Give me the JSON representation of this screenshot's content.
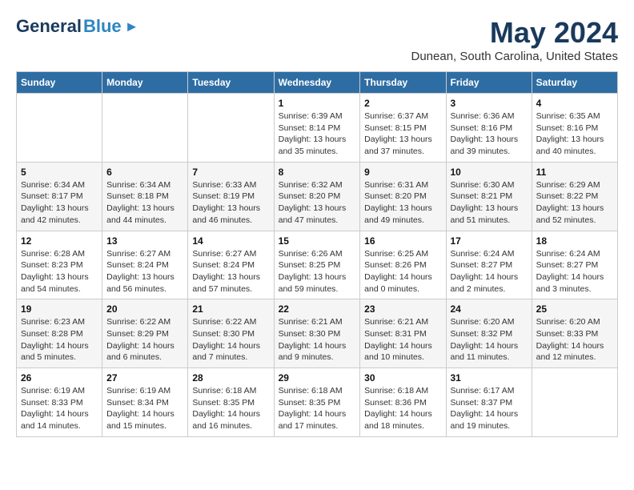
{
  "app": {
    "logo_general": "General",
    "logo_blue": "Blue",
    "month_year": "May 2024",
    "location": "Dunean, South Carolina, United States"
  },
  "calendar": {
    "headers": [
      "Sunday",
      "Monday",
      "Tuesday",
      "Wednesday",
      "Thursday",
      "Friday",
      "Saturday"
    ],
    "weeks": [
      [
        {
          "day": "",
          "info": ""
        },
        {
          "day": "",
          "info": ""
        },
        {
          "day": "",
          "info": ""
        },
        {
          "day": "1",
          "info": "Sunrise: 6:39 AM\nSunset: 8:14 PM\nDaylight: 13 hours\nand 35 minutes."
        },
        {
          "day": "2",
          "info": "Sunrise: 6:37 AM\nSunset: 8:15 PM\nDaylight: 13 hours\nand 37 minutes."
        },
        {
          "day": "3",
          "info": "Sunrise: 6:36 AM\nSunset: 8:16 PM\nDaylight: 13 hours\nand 39 minutes."
        },
        {
          "day": "4",
          "info": "Sunrise: 6:35 AM\nSunset: 8:16 PM\nDaylight: 13 hours\nand 40 minutes."
        }
      ],
      [
        {
          "day": "5",
          "info": "Sunrise: 6:34 AM\nSunset: 8:17 PM\nDaylight: 13 hours\nand 42 minutes."
        },
        {
          "day": "6",
          "info": "Sunrise: 6:34 AM\nSunset: 8:18 PM\nDaylight: 13 hours\nand 44 minutes."
        },
        {
          "day": "7",
          "info": "Sunrise: 6:33 AM\nSunset: 8:19 PM\nDaylight: 13 hours\nand 46 minutes."
        },
        {
          "day": "8",
          "info": "Sunrise: 6:32 AM\nSunset: 8:20 PM\nDaylight: 13 hours\nand 47 minutes."
        },
        {
          "day": "9",
          "info": "Sunrise: 6:31 AM\nSunset: 8:20 PM\nDaylight: 13 hours\nand 49 minutes."
        },
        {
          "day": "10",
          "info": "Sunrise: 6:30 AM\nSunset: 8:21 PM\nDaylight: 13 hours\nand 51 minutes."
        },
        {
          "day": "11",
          "info": "Sunrise: 6:29 AM\nSunset: 8:22 PM\nDaylight: 13 hours\nand 52 minutes."
        }
      ],
      [
        {
          "day": "12",
          "info": "Sunrise: 6:28 AM\nSunset: 8:23 PM\nDaylight: 13 hours\nand 54 minutes."
        },
        {
          "day": "13",
          "info": "Sunrise: 6:27 AM\nSunset: 8:24 PM\nDaylight: 13 hours\nand 56 minutes."
        },
        {
          "day": "14",
          "info": "Sunrise: 6:27 AM\nSunset: 8:24 PM\nDaylight: 13 hours\nand 57 minutes."
        },
        {
          "day": "15",
          "info": "Sunrise: 6:26 AM\nSunset: 8:25 PM\nDaylight: 13 hours\nand 59 minutes."
        },
        {
          "day": "16",
          "info": "Sunrise: 6:25 AM\nSunset: 8:26 PM\nDaylight: 14 hours\nand 0 minutes."
        },
        {
          "day": "17",
          "info": "Sunrise: 6:24 AM\nSunset: 8:27 PM\nDaylight: 14 hours\nand 2 minutes."
        },
        {
          "day": "18",
          "info": "Sunrise: 6:24 AM\nSunset: 8:27 PM\nDaylight: 14 hours\nand 3 minutes."
        }
      ],
      [
        {
          "day": "19",
          "info": "Sunrise: 6:23 AM\nSunset: 8:28 PM\nDaylight: 14 hours\nand 5 minutes."
        },
        {
          "day": "20",
          "info": "Sunrise: 6:22 AM\nSunset: 8:29 PM\nDaylight: 14 hours\nand 6 minutes."
        },
        {
          "day": "21",
          "info": "Sunrise: 6:22 AM\nSunset: 8:30 PM\nDaylight: 14 hours\nand 7 minutes."
        },
        {
          "day": "22",
          "info": "Sunrise: 6:21 AM\nSunset: 8:30 PM\nDaylight: 14 hours\nand 9 minutes."
        },
        {
          "day": "23",
          "info": "Sunrise: 6:21 AM\nSunset: 8:31 PM\nDaylight: 14 hours\nand 10 minutes."
        },
        {
          "day": "24",
          "info": "Sunrise: 6:20 AM\nSunset: 8:32 PM\nDaylight: 14 hours\nand 11 minutes."
        },
        {
          "day": "25",
          "info": "Sunrise: 6:20 AM\nSunset: 8:33 PM\nDaylight: 14 hours\nand 12 minutes."
        }
      ],
      [
        {
          "day": "26",
          "info": "Sunrise: 6:19 AM\nSunset: 8:33 PM\nDaylight: 14 hours\nand 14 minutes."
        },
        {
          "day": "27",
          "info": "Sunrise: 6:19 AM\nSunset: 8:34 PM\nDaylight: 14 hours\nand 15 minutes."
        },
        {
          "day": "28",
          "info": "Sunrise: 6:18 AM\nSunset: 8:35 PM\nDaylight: 14 hours\nand 16 minutes."
        },
        {
          "day": "29",
          "info": "Sunrise: 6:18 AM\nSunset: 8:35 PM\nDaylight: 14 hours\nand 17 minutes."
        },
        {
          "day": "30",
          "info": "Sunrise: 6:18 AM\nSunset: 8:36 PM\nDaylight: 14 hours\nand 18 minutes."
        },
        {
          "day": "31",
          "info": "Sunrise: 6:17 AM\nSunset: 8:37 PM\nDaylight: 14 hours\nand 19 minutes."
        },
        {
          "day": "",
          "info": ""
        }
      ]
    ]
  }
}
